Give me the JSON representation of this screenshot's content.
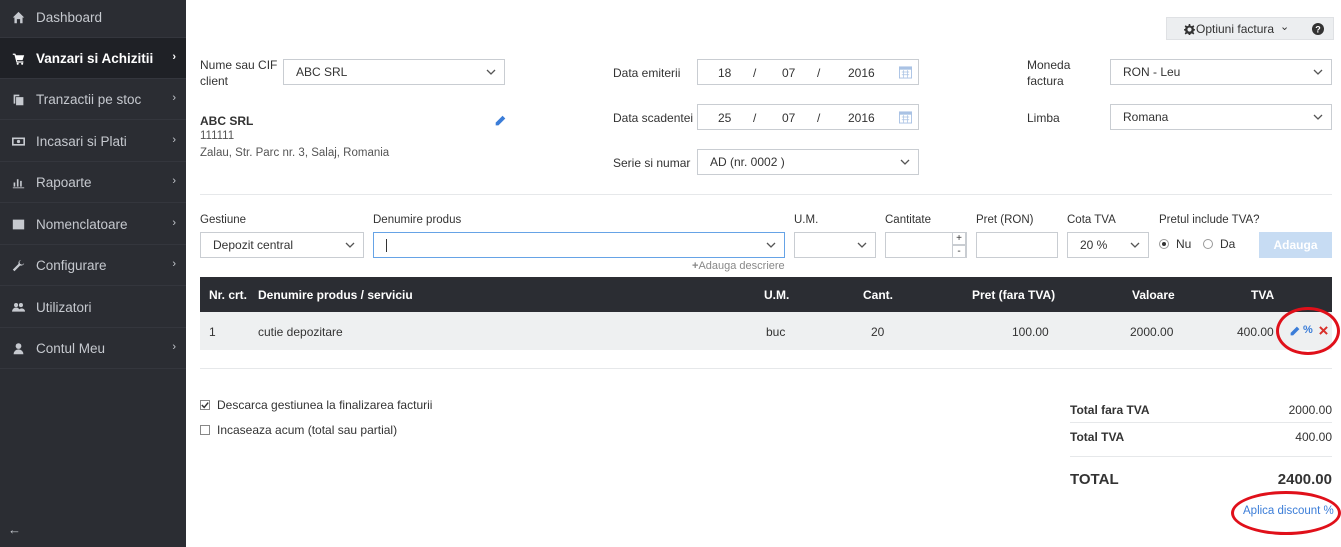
{
  "sidebar": {
    "items": [
      {
        "label": "Dashboard",
        "icon": "home-icon"
      },
      {
        "label": "Vanzari si Achizitii",
        "icon": "cart-icon"
      },
      {
        "label": "Tranzactii pe stoc",
        "icon": "copy-icon"
      },
      {
        "label": "Incasari si Plati",
        "icon": "money-icon"
      },
      {
        "label": "Rapoarte",
        "icon": "bar-chart-icon"
      },
      {
        "label": "Nomenclatoare",
        "icon": "list-icon"
      },
      {
        "label": "Configurare",
        "icon": "wrench-icon"
      },
      {
        "label": "Utilizatori",
        "icon": "users-icon"
      },
      {
        "label": "Contul Meu",
        "icon": "user-icon"
      }
    ],
    "active_index": 1
  },
  "toolbar": {
    "options_label": "Optiuni factura",
    "help_icon": "question-circle-icon"
  },
  "client": {
    "label_line1": "Nume sau CIF",
    "label_line2": "client",
    "value": "ABC SRL",
    "name": "ABC SRL",
    "cif": "111111",
    "address": "Zalau, Str. Parc nr. 3, Salaj, Romania"
  },
  "dates": {
    "issue_label": "Data emiterii",
    "issue": {
      "day": "18",
      "month": "07",
      "year": "2016"
    },
    "due_label": "Data scadentei",
    "due": {
      "day": "25",
      "month": "07",
      "year": "2016"
    },
    "sep": "/",
    "series_label": "Serie si numar",
    "series_value": "AD (nr. 0002 )"
  },
  "currency": {
    "label_line1": "Moneda",
    "label_line2": "factura",
    "value": "RON - Leu",
    "lang_label": "Limba",
    "lang_value": "Romana"
  },
  "product_form": {
    "gestiune_label": "Gestiune",
    "gestiune_value": "Depozit central",
    "denumire_label": "Denumire produs",
    "denumire_value": "",
    "um_label": "U.M.",
    "cantitate_label": "Cantitate",
    "pret_label": "Pret (RON)",
    "cota_label": "Cota TVA",
    "cota_value": "20 %",
    "include_label": "Pretul include TVA?",
    "nu_label": "Nu",
    "da_label": "Da",
    "add_button": "Adauga",
    "add_desc": "Adauga descriere",
    "plus": "+",
    "minus": "-"
  },
  "table": {
    "headers": [
      "Nr. crt.",
      "Denumire produs / serviciu",
      "U.M.",
      "Cant.",
      "Pret (fara TVA)",
      "Valoare",
      "TVA"
    ],
    "rows": [
      {
        "nr": "1",
        "name": "cutie depozitare",
        "um": "buc",
        "cant": "20",
        "pret": "100.00",
        "valoare": "2000.00",
        "tva": "400.00"
      }
    ],
    "discount_symbol": "%"
  },
  "options": {
    "descarca": "Descarca gestiunea la finalizarea facturii",
    "incaseaza": "Incaseaza acum (total sau partial)"
  },
  "totals": {
    "fara_tva_label": "Total fara TVA",
    "fara_tva": "2000.00",
    "tva_label": "Total TVA",
    "tva": "400.00",
    "total_label": "TOTAL",
    "total": "2400.00",
    "discount_link": "Aplica discount %"
  }
}
